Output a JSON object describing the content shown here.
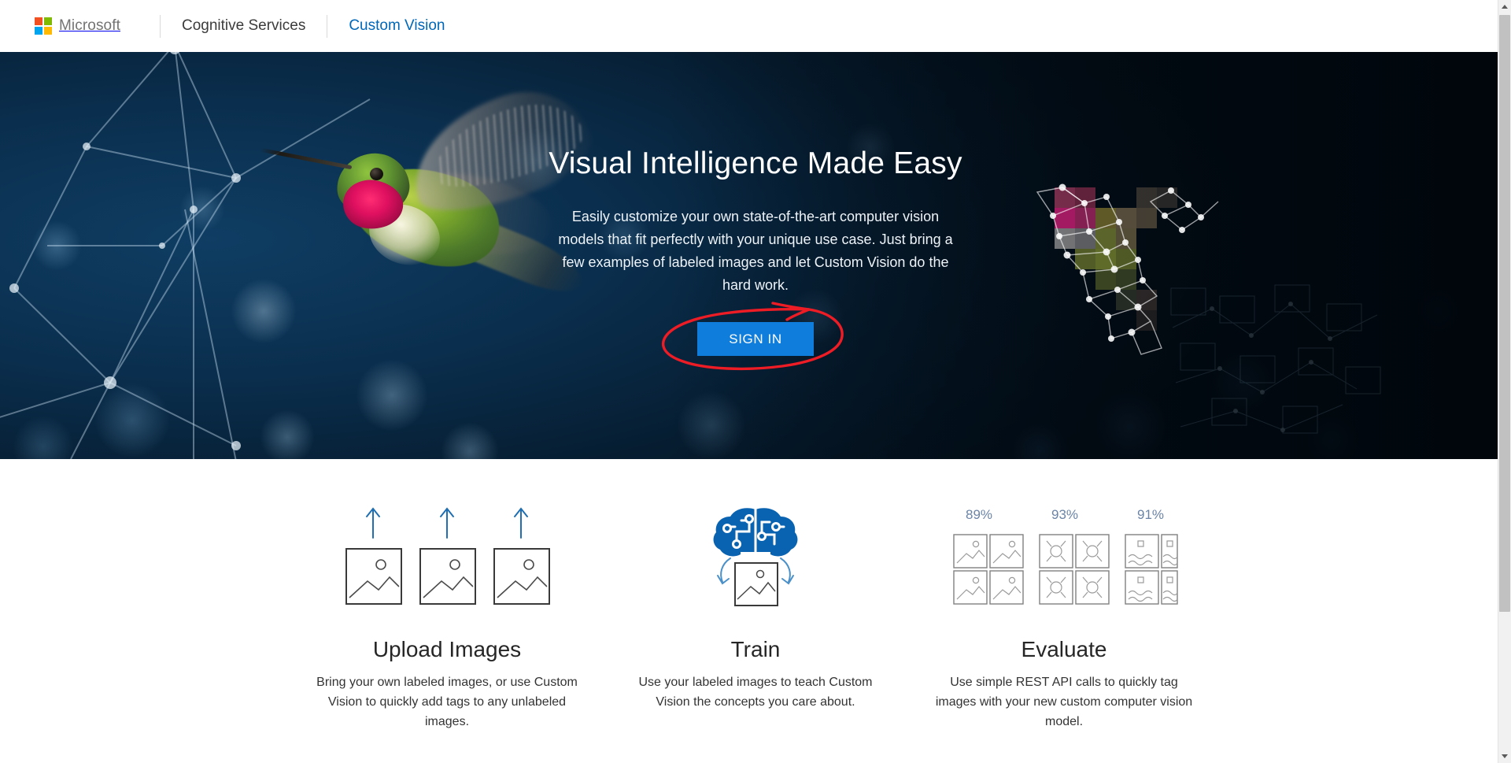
{
  "topnav": {
    "brand": "Microsoft",
    "brand_icon": "microsoft-logo-icon",
    "links": [
      {
        "label": "Cognitive Services",
        "accent": false
      },
      {
        "label": "Custom Vision",
        "accent": true
      }
    ]
  },
  "hero": {
    "title": "Visual Intelligence Made Easy",
    "subtitle": "Easily customize your own state-of-the-art computer vision models that fit perfectly with your unique use case. Just bring a few examples of labeled images and let Custom Vision do the hard work.",
    "signin_label": "SIGN IN",
    "annotation": "red-circle-highlight",
    "background_image": "hummingbird-network-hero-image"
  },
  "features": [
    {
      "icon": "upload-images-icon",
      "title": "Upload Images",
      "description": "Bring your own labeled images, or use Custom Vision to quickly add tags to any unlabeled images."
    },
    {
      "icon": "train-brain-icon",
      "title": "Train",
      "description": "Use your labeled images to teach Custom Vision the concepts you care about."
    },
    {
      "icon": "evaluate-scores-icon",
      "title": "Evaluate",
      "description": "Use simple REST API calls to quickly tag images with your new custom computer vision model.",
      "scores": [
        "89%",
        "93%",
        "91%"
      ]
    }
  ],
  "scrollbar": {
    "up_icon": "scroll-up-arrow-icon",
    "down_icon": "scroll-down-arrow-icon"
  },
  "colors": {
    "accent_blue": "#0067b8",
    "button_blue": "#0f7ddb",
    "annotation_red": "#ee1c25",
    "hero_dark": "#04192a",
    "score_text": "#6b84a6",
    "icon_blue": "#1f6fb2"
  }
}
